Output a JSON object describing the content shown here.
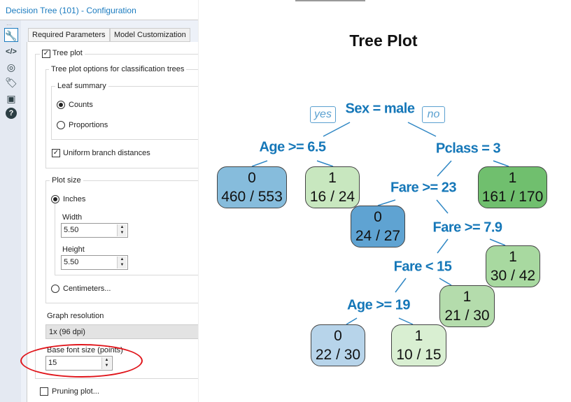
{
  "window": {
    "title": "Decision Tree (101) - Configuration"
  },
  "sidebar": {
    "icons": [
      "wrench-icon",
      "code-icon",
      "target-icon",
      "tag-icon",
      "box-icon",
      "help-icon"
    ]
  },
  "tabs": [
    {
      "label": "Required Parameters"
    },
    {
      "label": "Model Customization"
    }
  ],
  "form": {
    "tree_plot": {
      "label": "Tree plot",
      "checked": true
    },
    "classification_group": "Tree plot options for classification trees",
    "leaf_summary": {
      "label": "Leaf summary",
      "options": [
        {
          "label": "Counts",
          "selected": true
        },
        {
          "label": "Proportions",
          "selected": false
        }
      ]
    },
    "uniform_branch": {
      "label": "Uniform branch distances",
      "checked": true
    },
    "plot_size": {
      "label": "Plot size",
      "inches": {
        "label": "Inches",
        "selected": true
      },
      "width_label": "Width",
      "width_value": "5.50",
      "height_label": "Height",
      "height_value": "5.50",
      "centimeters": {
        "label": "Centimeters...",
        "selected": false
      }
    },
    "graph_resolution": {
      "label": "Graph resolution",
      "value": "1x (96 dpi)"
    },
    "base_font": {
      "label": "Base font size (points)",
      "value": "15"
    },
    "pruning_plot": {
      "label": "Pruning plot...",
      "checked": false
    }
  },
  "plot": {
    "title": "Tree Plot",
    "yes": "yes",
    "no": "no",
    "splits": [
      "Sex = male",
      "Age >= 6.5",
      "Pclass = 3",
      "Fare >= 23",
      "Fare >= 7.9",
      "Fare < 15",
      "Age >= 19"
    ],
    "leaves": [
      {
        "class": "0",
        "count": "460 / 553",
        "color": "#86bcdc"
      },
      {
        "class": "1",
        "count": "16 / 24",
        "color": "#c8e7bf"
      },
      {
        "class": "0",
        "count": "24 / 27",
        "color": "#5fa3d2"
      },
      {
        "class": "1",
        "count": "161 / 170",
        "color": "#70bf6e"
      },
      {
        "class": "1",
        "count": "30 / 42",
        "color": "#a8d9a0"
      },
      {
        "class": "1",
        "count": "21 / 30",
        "color": "#b4dcac"
      },
      {
        "class": "0",
        "count": "22 / 30",
        "color": "#b7d4ea"
      },
      {
        "class": "1",
        "count": "10 / 15",
        "color": "#d9efd2"
      }
    ]
  }
}
